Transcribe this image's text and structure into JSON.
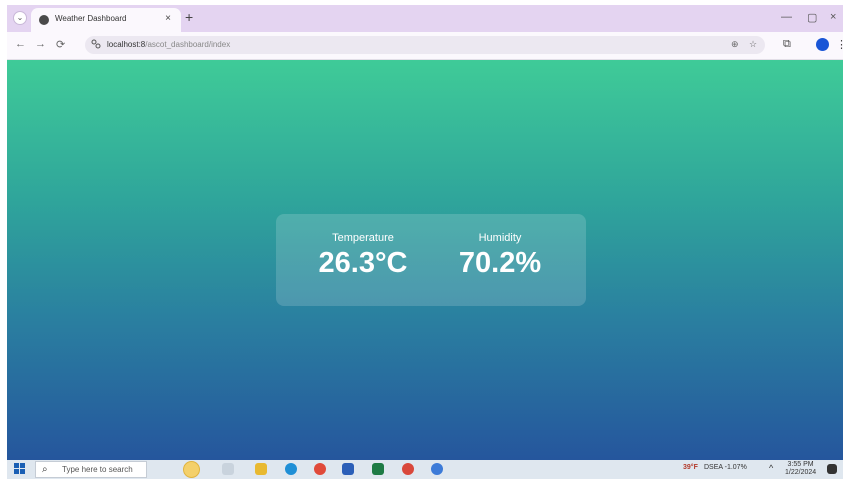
{
  "browser": {
    "tab_title": "Weather Dashboard",
    "tab_close": "×",
    "new_tab": "+",
    "url_host": "localhost:8",
    "url_path": "/ascot_dashboard/index",
    "window_controls": {
      "minimize": "—",
      "maximize": "▢",
      "close": "×"
    },
    "nav": {
      "back": "←",
      "forward": "→",
      "reload": "⟳"
    },
    "icons": {
      "site_info": "site-info-icon",
      "zoom": "zoom-icon",
      "bookmark": "star-icon",
      "extensions": "extensions-icon",
      "menu": "kebab-menu-icon"
    }
  },
  "dashboard": {
    "temperature": {
      "label": "Temperature",
      "value": "26.3°C"
    },
    "humidity": {
      "label": "Humidity",
      "value": "70.2%"
    }
  },
  "taskbar": {
    "search_placeholder": "Type here to search",
    "weather_widget": "39°F",
    "stock_ticker": "DSEA -1.07%",
    "time": "3:55 PM",
    "date": "1/22/2024",
    "colors": {
      "accent": "#1a5fb4"
    }
  },
  "theme": {
    "gradient_top": "#3fcb98",
    "gradient_bottom": "#25569d"
  }
}
